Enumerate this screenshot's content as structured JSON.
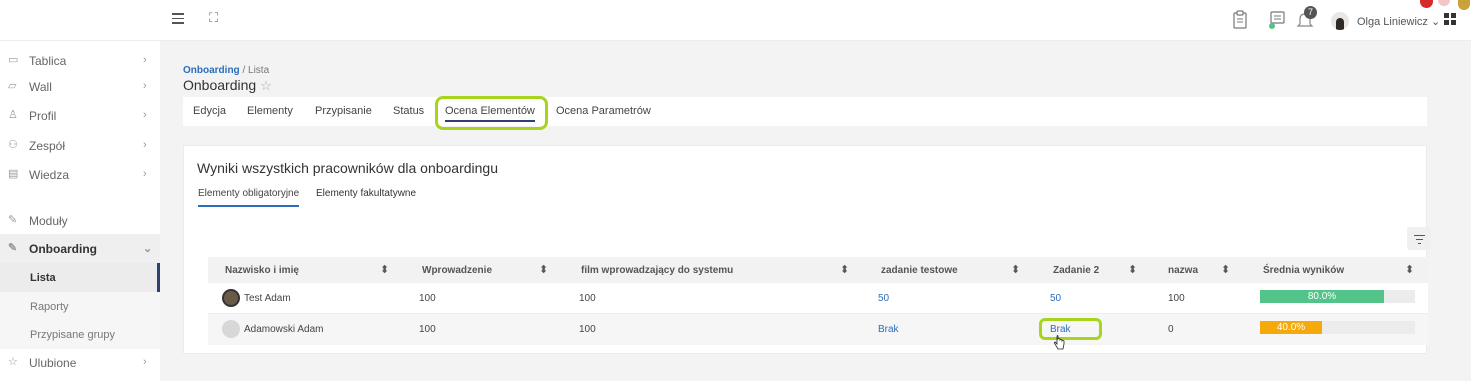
{
  "topbar": {
    "burger_icon": "menu-icon",
    "expand_icon": "fullscreen-icon",
    "notification_count": "7",
    "user_name": "Olga Liniewicz",
    "user_chevron": "⌄"
  },
  "sidebar": {
    "items": [
      {
        "label": "Tablica",
        "icon": "monitor-icon",
        "chevron": "›"
      },
      {
        "label": "Wall",
        "icon": "chat-icon",
        "chevron": "›"
      },
      {
        "label": "Profil",
        "icon": "user-icon",
        "chevron": "›"
      },
      {
        "label": "Zespół",
        "icon": "team-icon",
        "chevron": "›"
      },
      {
        "label": "Wiedza",
        "icon": "book-icon",
        "chevron": "›"
      },
      {
        "label": "Moduły",
        "icon": "puzzle-icon",
        "chevron": ""
      },
      {
        "label": "Onboarding",
        "icon": "puzzle-icon",
        "chevron": "⌄"
      },
      {
        "label": "Ulubione",
        "icon": "star-icon",
        "chevron": "›"
      }
    ],
    "sub_items": [
      {
        "label": "Lista"
      },
      {
        "label": "Raporty"
      },
      {
        "label": "Przypisane grupy"
      }
    ]
  },
  "breadcrumb": {
    "link": "Onboarding",
    "separator": " / ",
    "current": "Lista"
  },
  "page_title": "Onboarding",
  "tabs": [
    {
      "label": "Edycja"
    },
    {
      "label": "Elementy"
    },
    {
      "label": "Przypisanie"
    },
    {
      "label": "Status"
    },
    {
      "label": "Ocena Elementów"
    },
    {
      "label": "Ocena Parametrów"
    }
  ],
  "card": {
    "title": "Wyniki wszystkich pracowników dla onboardingu",
    "subtabs": [
      {
        "label": "Elementy obligatoryjne"
      },
      {
        "label": "Elementy fakultatywne"
      }
    ]
  },
  "table": {
    "headers": [
      "Nazwisko i imię",
      "Wprowadzenie",
      "film wprowadzający do systemu",
      "zadanie testowe",
      "Zadanie 2",
      "nazwa",
      "Średnia wyników"
    ],
    "sort_icon": "⬍",
    "rows": [
      {
        "name": "Test Adam",
        "c1": "100",
        "c2": "100",
        "c3": "50",
        "c4": "50",
        "c5": "100",
        "avg_label": "80.0%",
        "avg_value": 80,
        "avg_color": "#52c48a"
      },
      {
        "name": "Adamowski Adam",
        "c1": "100",
        "c2": "100",
        "c3": "Brak",
        "c4": "Brak",
        "c5": "0",
        "avg_label": "40.0%",
        "avg_value": 40,
        "avg_color": "#f5a90a"
      }
    ]
  },
  "colors": {
    "accent": "#2d4070",
    "link": "#2a6ebb",
    "highlight": "#a6d51c"
  }
}
